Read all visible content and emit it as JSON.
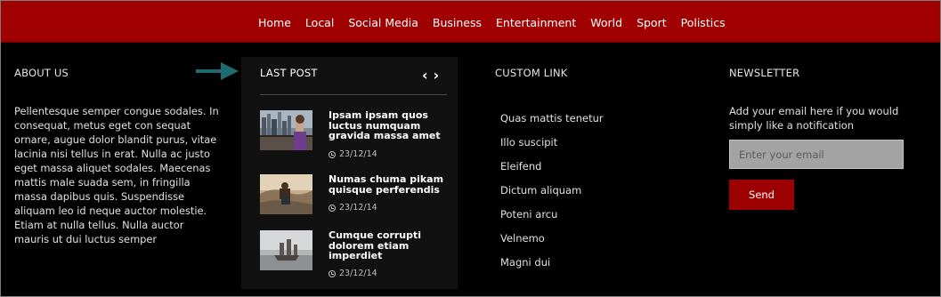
{
  "nav": {
    "items": [
      {
        "label": "Home"
      },
      {
        "label": "Local"
      },
      {
        "label": "Social Media"
      },
      {
        "label": "Business"
      },
      {
        "label": "Entertainment"
      },
      {
        "label": "World"
      },
      {
        "label": "Sport"
      },
      {
        "label": "Polistics"
      }
    ]
  },
  "about": {
    "title": "ABOUT US",
    "text": "Pellentesque semper congue sodales. In consequat, metus eget con sequat ornare, augue dolor blandit purus, vitae lacinia nisi tellus in erat. Nulla ac justo eget massa aliquet sodales. Maecenas mattis male suada sem, in fringilla massa dapibus quis. Suspendisse aliquam leo id neque auctor molestie. Etiam at nulla tellus. Nulla auctor mauris ut dui luctus semper"
  },
  "last_post": {
    "title": "LAST POST",
    "prev_icon": "chevron-left-icon",
    "next_icon": "chevron-right-icon",
    "posts": [
      {
        "title": "Ipsam ipsam quos luctus numquam gravida massa amet",
        "date": "23/12/14",
        "thumb": "city-skyline"
      },
      {
        "title": "Numas chuma pikam quisque perferendis",
        "date": "23/12/14",
        "thumb": "photographer-rocks"
      },
      {
        "title": "Cumque corrupti dolorem etiam imperdiet",
        "date": "23/12/14",
        "thumb": "ships-sea"
      }
    ]
  },
  "custom_link": {
    "title": "CUSTOM LINK",
    "links": [
      {
        "label": "Quas mattis tenetur"
      },
      {
        "label": "Illo suscipit"
      },
      {
        "label": "Eleifend"
      },
      {
        "label": "Dictum aliquam"
      },
      {
        "label": "Poteni arcu"
      },
      {
        "label": "Velnemo"
      },
      {
        "label": "Magni dui"
      }
    ]
  },
  "newsletter": {
    "title": "NEWSLETTER",
    "text": "Add your email here if you would simply like a notification",
    "placeholder": "Enter your email",
    "value": "",
    "send_label": "Send"
  },
  "colors": {
    "nav_bg": "#a00000",
    "accent": "#9c0000",
    "panel_bg": "#111111",
    "arrow_teal": "#1f6a6f"
  }
}
